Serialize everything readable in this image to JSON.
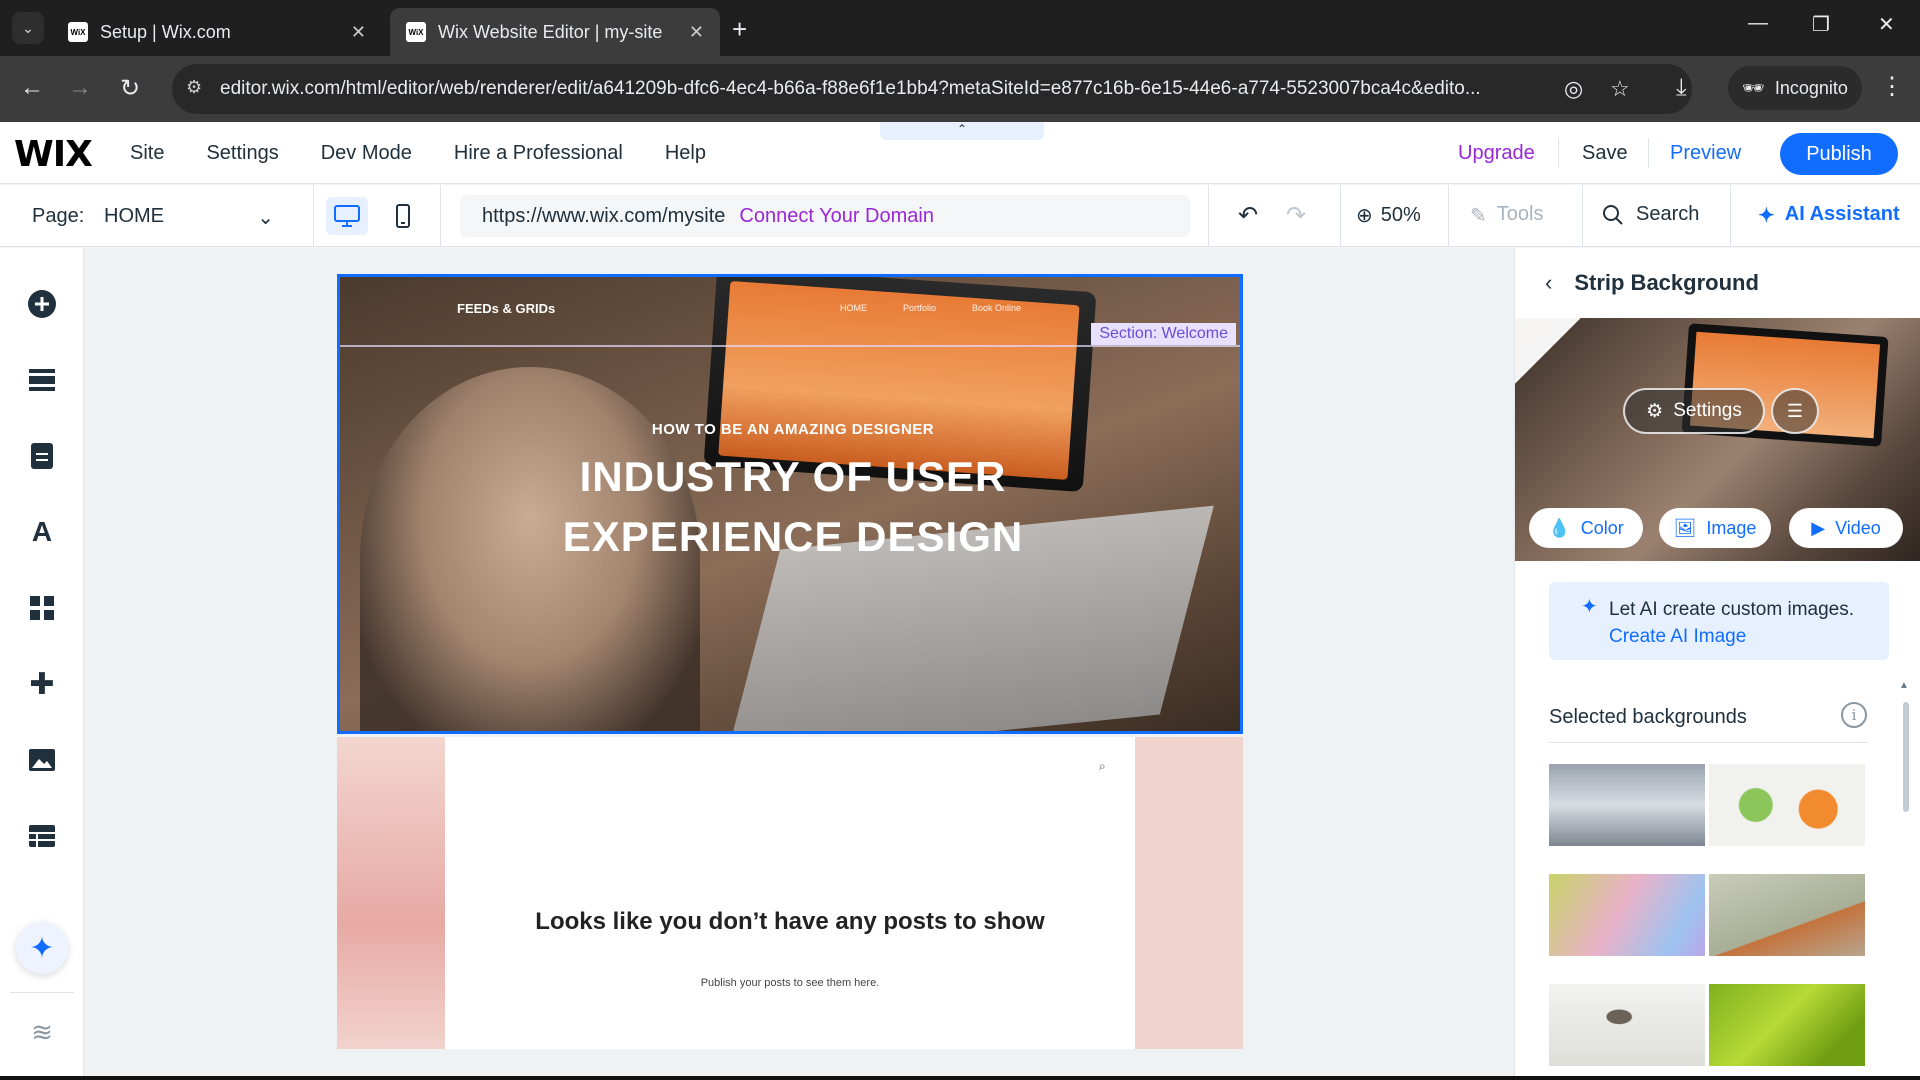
{
  "browser": {
    "tabs": [
      {
        "title": "Setup | Wix.com",
        "favicon": "WiX"
      },
      {
        "title": "Wix Website Editor | my-site",
        "favicon": "WiX"
      }
    ],
    "url": "editor.wix.com/html/editor/web/renderer/edit/a641209b-dfc6-4ec4-b66a-f88e6f1e1bb4?metaSiteId=e877c16b-6e15-44e6-a774-5523007bca4c&edito...",
    "incognito_label": "Incognito"
  },
  "wix_top": {
    "logo": "WIX",
    "menu": [
      "Site",
      "Settings",
      "Dev Mode",
      "Hire a Professional",
      "Help"
    ],
    "upgrade": "Upgrade",
    "save": "Save",
    "preview": "Preview",
    "publish": "Publish"
  },
  "toolbar": {
    "page_label": "Page:",
    "page_value": "HOME",
    "site_url": "https://www.wix.com/mysite",
    "connect_domain": "Connect Your Domain",
    "zoom": "50%",
    "tools": "Tools",
    "search": "Search",
    "ai_assistant": "AI Assistant"
  },
  "canvas": {
    "hero": {
      "logo": "FEEDs & GRIDs",
      "nav": [
        "HOME",
        "Portfolio",
        "Book Online"
      ],
      "section_tag": "Section: Welcome",
      "kicker": "HOW TO BE AN AMAZING DESIGNER",
      "title_line1": "INDUSTRY OF USER",
      "title_line2": "EXPERIENCE DESIGN"
    },
    "blog": {
      "empty_title": "Looks like you don’t have any posts to show",
      "empty_sub": "Publish your posts to see them here."
    }
  },
  "panel": {
    "title": "Strip Background",
    "settings": "Settings",
    "type_buttons": [
      "Color",
      "Image",
      "Video"
    ],
    "ai_text": "Let AI create custom images.",
    "ai_link": "Create AI Image",
    "selected_title": "Selected backgrounds"
  },
  "colors": {
    "accent": "#116dff",
    "upgrade": "#9a27d5",
    "selection": "#116dff"
  }
}
